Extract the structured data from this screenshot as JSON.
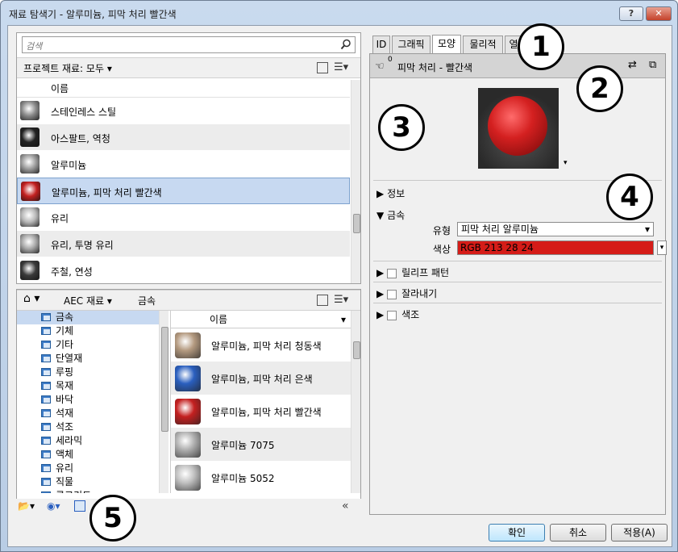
{
  "window": {
    "title": "재료 탐색기 - 알루미늄, 피막 처리 빨간색",
    "help_label": "?",
    "close_label": "✕"
  },
  "search": {
    "placeholder": "검색"
  },
  "project": {
    "crumb": "프로젝트 재료: 모두",
    "column_header": "이름",
    "items": [
      {
        "label": "스테인레스 스틸",
        "color": "#8a8a8a"
      },
      {
        "label": "아스팔트, 역청",
        "color": "#222222"
      },
      {
        "label": "알루미늄",
        "color": "#9c9c9c"
      },
      {
        "label": "알루미늄, 피막 처리 빨간색",
        "color": "#c22020"
      },
      {
        "label": "유리",
        "color": "#b8b8b8"
      },
      {
        "label": "유리, 투명 유리",
        "color": "#a8a8a8"
      },
      {
        "label": "주철, 연성",
        "color": "#3a3a3a"
      }
    ]
  },
  "library": {
    "crumb_home": "home-icon",
    "crumb_1": "AEC 재료",
    "crumb_2": "금속",
    "column_header": "이름",
    "tree": [
      "금속",
      "기체",
      "기타",
      "단열재",
      "루핑",
      "목재",
      "바닥",
      "석재",
      "석조",
      "세라믹",
      "액체",
      "유리",
      "직물",
      "콘크리트"
    ],
    "items": [
      {
        "label": "알루미늄, 피막 처리 청동색",
        "color": "#b49a80"
      },
      {
        "label": "알루미늄, 피막 처리 은색",
        "color": "#2a5fbf"
      },
      {
        "label": "알루미늄, 피막 처리 빨간색",
        "color": "#c42020"
      },
      {
        "label": "알루미늄 7075",
        "color": "#b0b0b0"
      },
      {
        "label": "알루미늄 5052",
        "color": "#c0c0c0"
      }
    ]
  },
  "tabs": [
    "ID",
    "그래픽",
    "모양",
    "물리적",
    "열"
  ],
  "appearance": {
    "asset_count": "0",
    "asset_name": "피막 처리 - 빨간색",
    "sections": {
      "info": "정보",
      "metal": "금속",
      "relief": "릴리프 패턴",
      "cutout": "잘라내기",
      "tint": "색조"
    },
    "type_label": "유형",
    "type_value": "피막 처리 알루미늄",
    "color_label": "색상",
    "color_value": "RGB 213 28 24",
    "color_hex": "#d51c18"
  },
  "callouts": [
    "1",
    "2",
    "3",
    "4",
    "5"
  ],
  "buttons": {
    "ok": "확인",
    "cancel": "취소",
    "apply": "적용(A)"
  }
}
